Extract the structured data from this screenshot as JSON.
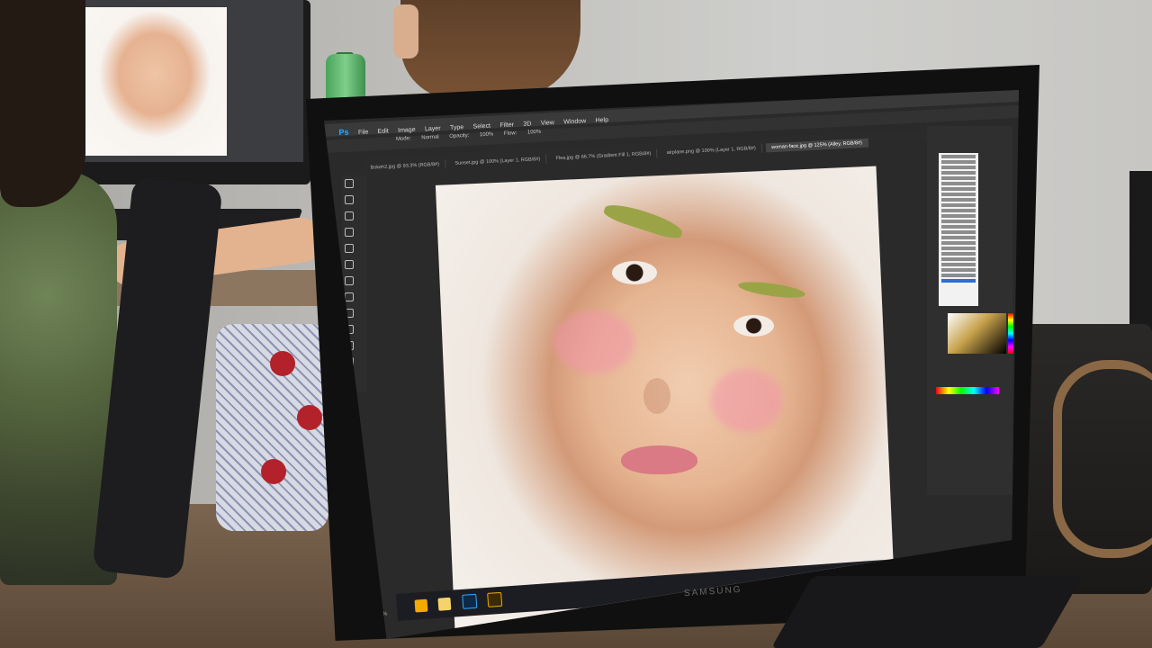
{
  "scene": {
    "type": "photo of office desk with monitor showing image editor",
    "monitor_brand": "SAMSUNG"
  },
  "photoshop": {
    "app_logo": "Ps",
    "menu": [
      "File",
      "Edit",
      "Image",
      "Layer",
      "Type",
      "Select",
      "Filter",
      "3D",
      "View",
      "Window",
      "Help"
    ],
    "options_bar": {
      "mode_label": "Mode:",
      "mode_value": "Normal",
      "opacity_label": "Opacity:",
      "opacity_value": "100%",
      "flow_label": "Flow:",
      "flow_value": "100%"
    },
    "tabs": [
      "Bokeh2.jpg @ 93.3% (RGB/8#)",
      "Sunset.jpg @ 100% (Layer 1, RGB/8#)",
      "Flea.jpg @ 66.7% (Gradient Fill 1, RGB/8#)",
      "airplane.png @ 100% (Layer 1, RGB/8#)",
      "woman-face.jpg @ 125% (Alley, RGB/8#)"
    ],
    "zoom": "125%"
  },
  "colors": {
    "accent": "#31a8ff",
    "panel_bg": "#2f2f2f",
    "menu_bg": "#3a3a3a",
    "brow_paint": "#9aa447",
    "lip": "#d97a84"
  },
  "icons": [
    "move-tool-icon",
    "marquee-tool-icon",
    "lasso-tool-icon",
    "quick-select-icon",
    "crop-tool-icon",
    "eyedropper-icon",
    "healing-brush-icon",
    "brush-tool-icon",
    "clone-stamp-icon",
    "history-brush-icon",
    "eraser-icon",
    "gradient-icon",
    "blur-icon",
    "dodge-icon",
    "pen-icon",
    "type-icon",
    "path-select-icon",
    "shape-icon",
    "hand-icon",
    "zoom-icon"
  ]
}
